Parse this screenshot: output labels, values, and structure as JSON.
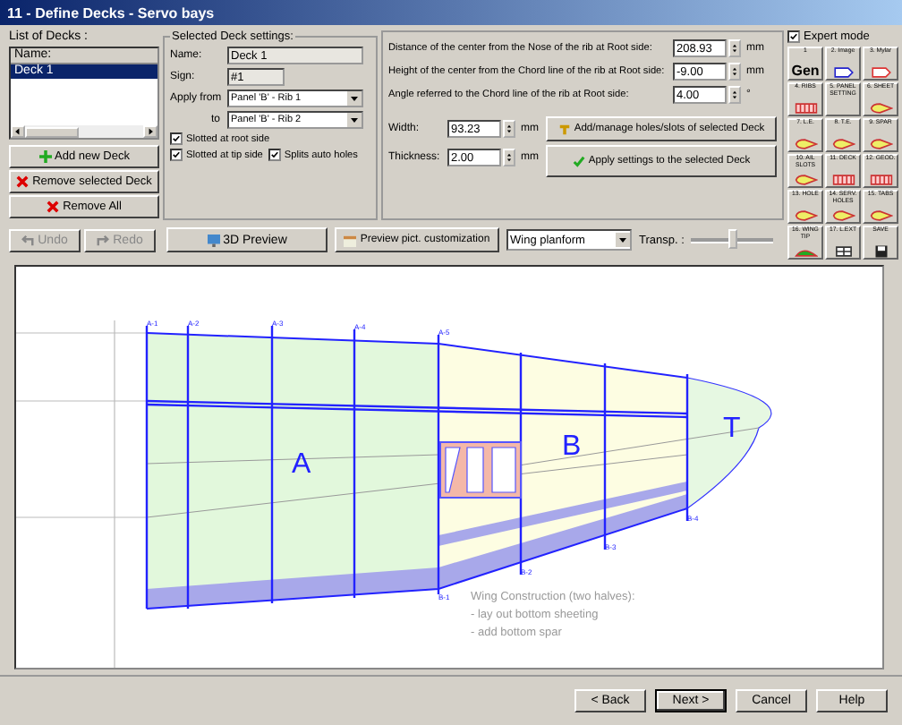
{
  "window": {
    "title": "11 - Define Decks - Servo bays"
  },
  "deck_list": {
    "label": "List of Decks :",
    "column": "Name:",
    "items": [
      {
        "name": "Deck 1",
        "selected": true
      }
    ]
  },
  "list_buttons": [
    {
      "label": "Add new Deck",
      "kind": "add"
    },
    {
      "label": "Remove selected Deck",
      "kind": "remove"
    },
    {
      "label": "Remove All",
      "kind": "remove"
    }
  ],
  "history_buttons": [
    {
      "label": "Undo",
      "kind": "undo",
      "disabled": true
    },
    {
      "label": "Redo",
      "kind": "redo",
      "disabled": true
    }
  ],
  "settings": {
    "title": "Selected Deck settings:",
    "name_label": "Name:",
    "name": "Deck 1",
    "sign_label": "Sign:",
    "sign": "#1",
    "apply_from_label": "Apply from",
    "apply_from": "Panel 'B' - Rib 1",
    "to_label": "to",
    "apply_to": "Panel 'B' - Rib 2",
    "checks": [
      {
        "label": "Slotted at root side",
        "checked": true
      },
      {
        "label": "Slotted at tip side",
        "checked": true
      },
      {
        "label": "Splits auto holes",
        "checked": true
      }
    ]
  },
  "position_fields": [
    {
      "label": "Distance of the center from the Nose of the rib at Root side:",
      "value": "208.93",
      "unit": "mm"
    },
    {
      "label": "Height of the center from the Chord line of the rib at Root side:",
      "value": "-9.00",
      "unit": "mm"
    },
    {
      "label": "Angle referred to the Chord line of the rib at Root side:",
      "value": "4.00",
      "unit": "°"
    }
  ],
  "size_fields": [
    {
      "label": "Width:",
      "value": "93.23",
      "unit": "mm"
    },
    {
      "label": "Thickness:",
      "value": "2.00",
      "unit": "mm"
    }
  ],
  "action_buttons": [
    {
      "label": "Add/manage holes/slots of selected Deck",
      "kind": "holes"
    },
    {
      "label": "Apply settings to the selected Deck",
      "kind": "apply"
    }
  ],
  "expert_mode": {
    "label": "Expert mode",
    "checked": true
  },
  "tools": [
    {
      "caption": "1",
      "label": "Gen",
      "kind": "text"
    },
    {
      "caption": "2. Image",
      "kind": "outline"
    },
    {
      "caption": "3. Mylar",
      "kind": "outline"
    },
    {
      "caption": "4. RIBS",
      "kind": "ribs"
    },
    {
      "caption": "5. PANEL SETTING",
      "kind": "none"
    },
    {
      "caption": "6. SHEET",
      "kind": "wing"
    },
    {
      "caption": "7. L.E.",
      "kind": "wing"
    },
    {
      "caption": "8. T.E.",
      "kind": "wing"
    },
    {
      "caption": "9. SPAR",
      "kind": "wing"
    },
    {
      "caption": "10. AIL SLOTS",
      "kind": "wing"
    },
    {
      "caption": "11. DECK",
      "kind": "ribs"
    },
    {
      "caption": "12. GEOD.",
      "kind": "ribs"
    },
    {
      "caption": "13. HOLE",
      "kind": "wing"
    },
    {
      "caption": "14. SERV. HOLES",
      "kind": "wing"
    },
    {
      "caption": "15. TABS",
      "kind": "wing"
    },
    {
      "caption": "16. WING TIP",
      "kind": "tip"
    },
    {
      "caption": "17. L.EXT",
      "kind": "grid"
    },
    {
      "caption": "SAVE",
      "kind": "save"
    }
  ],
  "preview_bar": {
    "preview_3d": "3D Preview",
    "preview_custom": "Preview pict. customization",
    "view": "Wing planform",
    "transp_label": "Transp. :",
    "transp": {
      "level": 0.5
    }
  },
  "drawing": {
    "panels": [
      "A",
      "B",
      "T"
    ],
    "rib_labels": [
      "A-1",
      "A-2",
      "A-3",
      "A-4",
      "A-5",
      "B-1",
      "B-2",
      "B-3",
      "B-4"
    ],
    "note": [
      "Wing Construction (two halves):",
      "- lay out bottom sheeting",
      "- add bottom spar"
    ]
  },
  "footer_buttons": [
    {
      "label": "< Back",
      "default": false
    },
    {
      "label": "Next >",
      "default": true
    },
    {
      "label": "Cancel",
      "default": false
    },
    {
      "label": "Help",
      "default": false
    }
  ]
}
